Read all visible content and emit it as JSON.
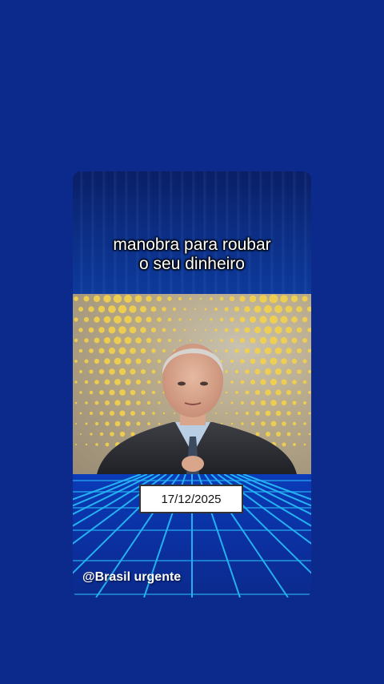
{
  "caption": {
    "line1": "manobra para roubar",
    "line2": "o seu dinheiro"
  },
  "video": {
    "subject": "presenter-in-suit"
  },
  "date_label": "17/12/2025",
  "handle": "@Brasil urgente",
  "colors": {
    "background": "#0b2a8c",
    "grid_lines": "#29c8ff",
    "dots": "#f3d24a"
  }
}
